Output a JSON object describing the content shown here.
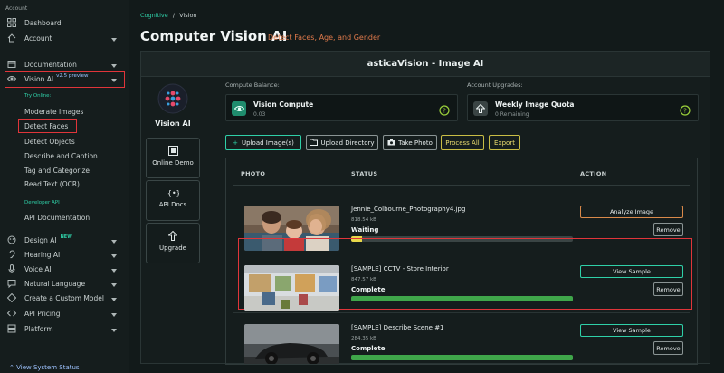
{
  "sidebar": {
    "section_account": "Account",
    "items_top": [
      {
        "label": "Dashboard",
        "icon": "dashboard-icon"
      },
      {
        "label": "Account",
        "icon": "home-icon"
      }
    ],
    "documentation": "Documentation",
    "vision_ai": "Vision AI",
    "vision_badge": "v2.5 preview",
    "try_online": "Try Online:",
    "try_items": [
      "Moderate Images",
      "Detect Faces",
      "Detect Objects",
      "Describe and Caption",
      "Tag and Categorize",
      "Read Text (OCR)"
    ],
    "developer_api": "Developer API",
    "api_documentation": "API Documentation",
    "design_ai": "Design AI",
    "new_badge": "NEW",
    "lower_items": [
      "Hearing AI",
      "Voice AI",
      "Natural Language",
      "Create a Custom Model",
      "API Pricing",
      "Platform"
    ],
    "view_system_status": "View System Status"
  },
  "breadcrumb": {
    "root": "Cognitive",
    "sep": "/",
    "current": "Vision"
  },
  "page": {
    "title": "Computer Vision AI",
    "subtitle": "Detect Faces, Age, and Gender"
  },
  "panel": {
    "title": "asticaVision - Image AI",
    "logo_label": "Vision AI",
    "nav": [
      "Online Demo",
      "API Docs",
      "Upgrade"
    ],
    "compute_label": "Compute Balance:",
    "compute_title": "Vision Compute",
    "compute_value": "0.03",
    "upgrades_label": "Account Upgrades:",
    "quota_title": "Weekly Image Quota",
    "quota_value": "0 Remaining",
    "buttons": {
      "upload_images": "Upload Image(s)",
      "upload_directory": "Upload Directory",
      "take_photo": "Take Photo",
      "process_all": "Process All",
      "export": "Export"
    },
    "columns": {
      "photo": "PHOTO",
      "status": "STATUS",
      "action": "ACTION"
    },
    "rows": [
      {
        "filename": "Jennie_Colbourne_Photography4.jpg",
        "size": "818.54 kB",
        "status": "Waiting",
        "progress": 0.05,
        "bar_color": "#e8d84a",
        "action": "Analyze Image",
        "remove": "Remove"
      },
      {
        "filename": "[SAMPLE] CCTV - Store Interior",
        "size": "847.57 kB",
        "status": "Complete",
        "progress": 1.0,
        "bar_color": "#3fa64a",
        "action": "View Sample",
        "remove": "Remove"
      },
      {
        "filename": "[SAMPLE] Describe Scene #1",
        "size": "284.35 kB",
        "status": "Complete",
        "progress": 1.0,
        "bar_color": "#3fa64a",
        "action": "View Sample",
        "remove": "Remove"
      }
    ]
  },
  "colors": {
    "accent": "#2fd0a8",
    "highlight": "#e0353a",
    "subtitle": "#e07a4b"
  }
}
